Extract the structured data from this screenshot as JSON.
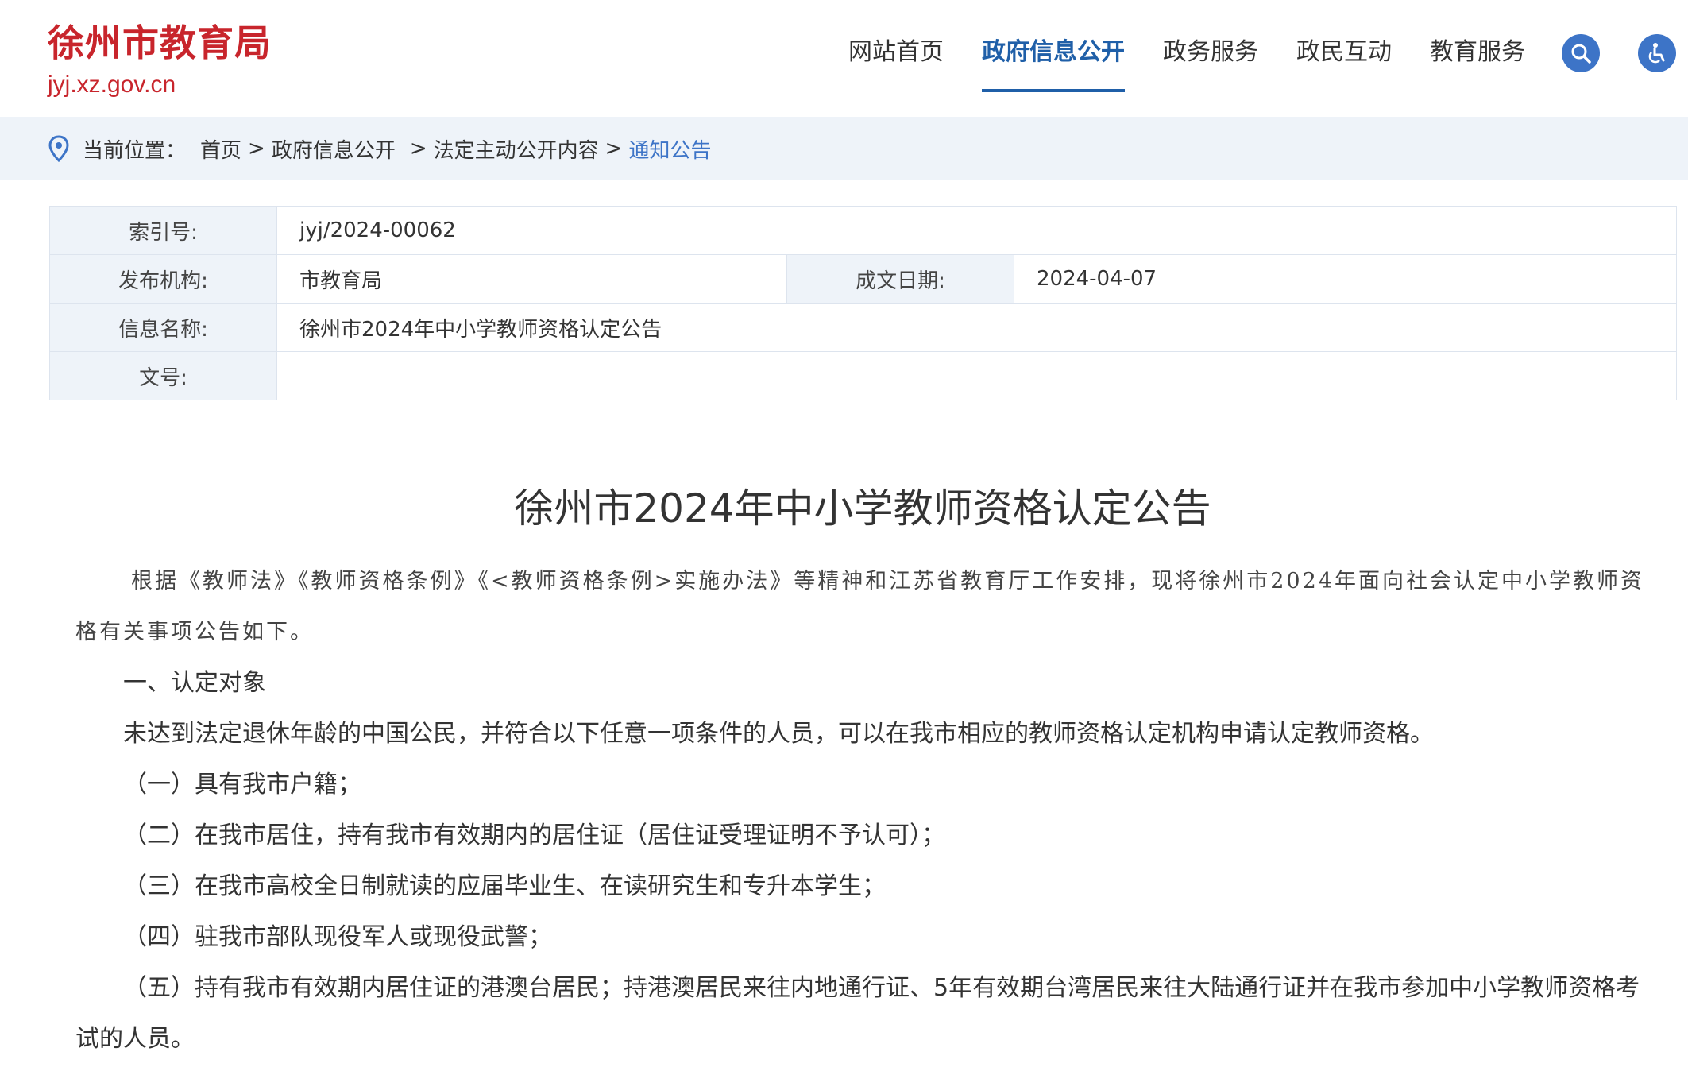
{
  "site": {
    "title": "徐州市教育局",
    "domain": "jyj.xz.gov.cn"
  },
  "nav": {
    "items": [
      {
        "label": "网站首页"
      },
      {
        "label": "政府信息公开"
      },
      {
        "label": "政务服务"
      },
      {
        "label": "政民互动"
      },
      {
        "label": "教育服务"
      }
    ],
    "active_index": 1,
    "icons": [
      "search-icon",
      "accessibility-icon"
    ]
  },
  "breadcrumb": {
    "label": "当前位置：",
    "items": [
      "首页",
      "政府信息公开",
      "法定主动公开内容",
      "通知公告"
    ],
    "separator": ">"
  },
  "meta": {
    "index_label": "索引号:",
    "index_value": "jyj/2024-00062",
    "publisher_label": "发布机构:",
    "publisher_value": "市教育局",
    "date_label": "成文日期:",
    "date_value": "2024-04-07",
    "name_label": "信息名称:",
    "name_value": "徐州市2024年中小学教师资格认定公告",
    "docno_label": "文号:",
    "docno_value": ""
  },
  "article": {
    "title": "徐州市2024年中小学教师资格认定公告",
    "intro": "根据《教师法》《教师资格条例》《<教师资格条例>实施办法》等精神和江苏省教育厅工作安排，现将徐州市2024年面向社会认定中小学教师资格有关事项公告如下。",
    "section1_heading": "一、认定对象",
    "section1_desc": "未达到法定退休年龄的中国公民，并符合以下任意一项条件的人员，可以在我市相应的教师资格认定机构申请认定教师资格。",
    "items": [
      "（一）具有我市户籍；",
      "（二）在我市居住，持有我市有效期内的居住证（居住证受理证明不予认可）；",
      "（三）在我市高校全日制就读的应届毕业生、在读研究生和专升本学生；",
      "（四）驻我市部队现役军人或现役武警；",
      "（五）持有我市有效期内居住证的港澳台居民；持港澳居民来往内地通行证、5年有效期台湾居民来往大陆通行证并在我市参加中小学教师资格考试的人员。"
    ]
  },
  "colors": {
    "brand_red": "#c8252c",
    "accent_blue": "#1f5fa8",
    "icon_blue": "#3d74c7",
    "band_bg": "#eef3f9"
  }
}
